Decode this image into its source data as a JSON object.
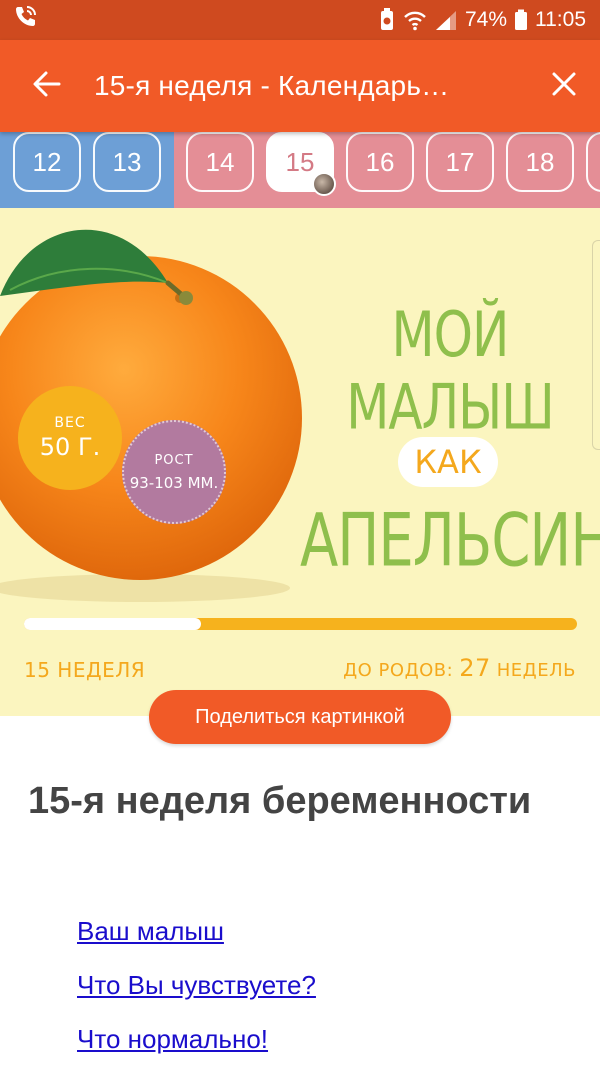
{
  "status_bar": {
    "battery_percent": "74%",
    "time": "11:05"
  },
  "app_bar": {
    "title": "15-я неделя - Календарь…"
  },
  "week_strip": {
    "weeks": [
      "12",
      "13",
      "14",
      "15",
      "16",
      "17",
      "18"
    ],
    "selected": "15",
    "colors": {
      "past": "#6d9fd6",
      "current": "#e48e96"
    }
  },
  "banner": {
    "weight_label": "ВЕС",
    "weight_value": "50 Г.",
    "height_label": "РОСТ",
    "height_value": "93-103 ММ.",
    "headline_line1": "МОЙ МАЛЫШ",
    "headline_kak": "КАК",
    "headline_line3": "АПЕЛЬСИН",
    "progress_fraction": 0.32,
    "week_label": "15 НЕДЕЛЯ",
    "due_prefix": "ДО РОДОВ:",
    "due_weeks": "27",
    "due_suffix": "НЕДЕЛЬ"
  },
  "share_button": "Поделиться картинкой",
  "content": {
    "heading": "15-я неделя беременности",
    "links": [
      "Ваш малыш",
      "Что Вы чувствуете?",
      "Что нормально!"
    ]
  },
  "colors": {
    "accent": "#f15a27",
    "status_bar": "#cf4a1f",
    "banner_bg": "#fbf5bf",
    "headline_green": "#8fbf4c",
    "yellow": "#f6b21d",
    "link": "#1a0dcc"
  }
}
